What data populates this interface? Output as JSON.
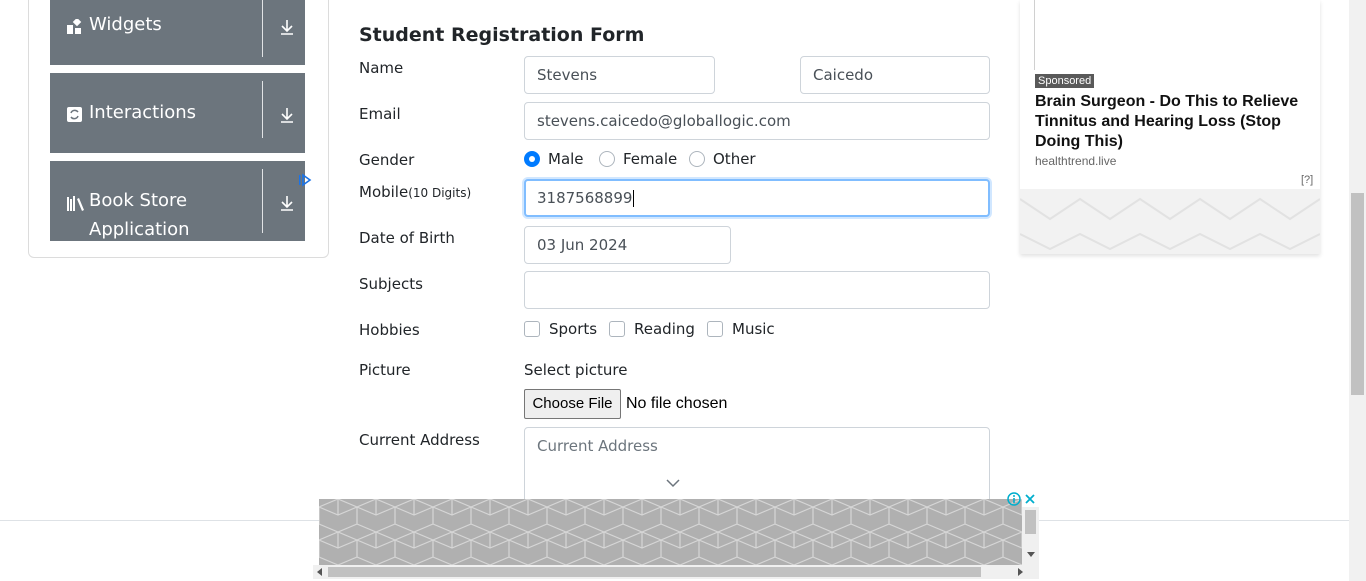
{
  "sidebar": {
    "groups": [
      {
        "label": "Widgets",
        "icon": "widgets-icon"
      },
      {
        "label": "Interactions",
        "icon": "interactions-icon"
      },
      {
        "label_line1": "Book Store",
        "label_line2": "Application",
        "icon": "bookstore-icon"
      }
    ]
  },
  "form": {
    "title": "Student Registration Form",
    "name_label": "Name",
    "first_name": "Stevens",
    "last_name": "Caicedo",
    "email_label": "Email",
    "email": "stevens.caicedo@globallogic.com",
    "gender_label": "Gender",
    "gender_options": [
      "Male",
      "Female",
      "Other"
    ],
    "gender_selected": "Male",
    "mobile_label": "Mobile",
    "mobile_hint": "(10 Digits)",
    "mobile": "3187568899",
    "dob_label": "Date of Birth",
    "dob": "03 Jun 2024",
    "subjects_label": "Subjects",
    "subjects": "",
    "hobbies_label": "Hobbies",
    "hobbies": [
      "Sports",
      "Reading",
      "Music"
    ],
    "picture_label": "Picture",
    "select_picture": "Select picture",
    "choose_file": "Choose File",
    "no_file": "No file chosen",
    "address_label": "Current Address",
    "address_placeholder": "Current Address"
  },
  "ad_right": {
    "sponsored": "Sponsored",
    "headline": "Brain Surgeon - Do This to Relieve Tinnitus and Hearing Loss (Stop Doing This)",
    "source": "healthtrend.live",
    "info": "[?]"
  },
  "colors": {
    "sidebar_bg": "#6c757d",
    "accent": "#007bff",
    "focus_border": "#80bdff"
  }
}
